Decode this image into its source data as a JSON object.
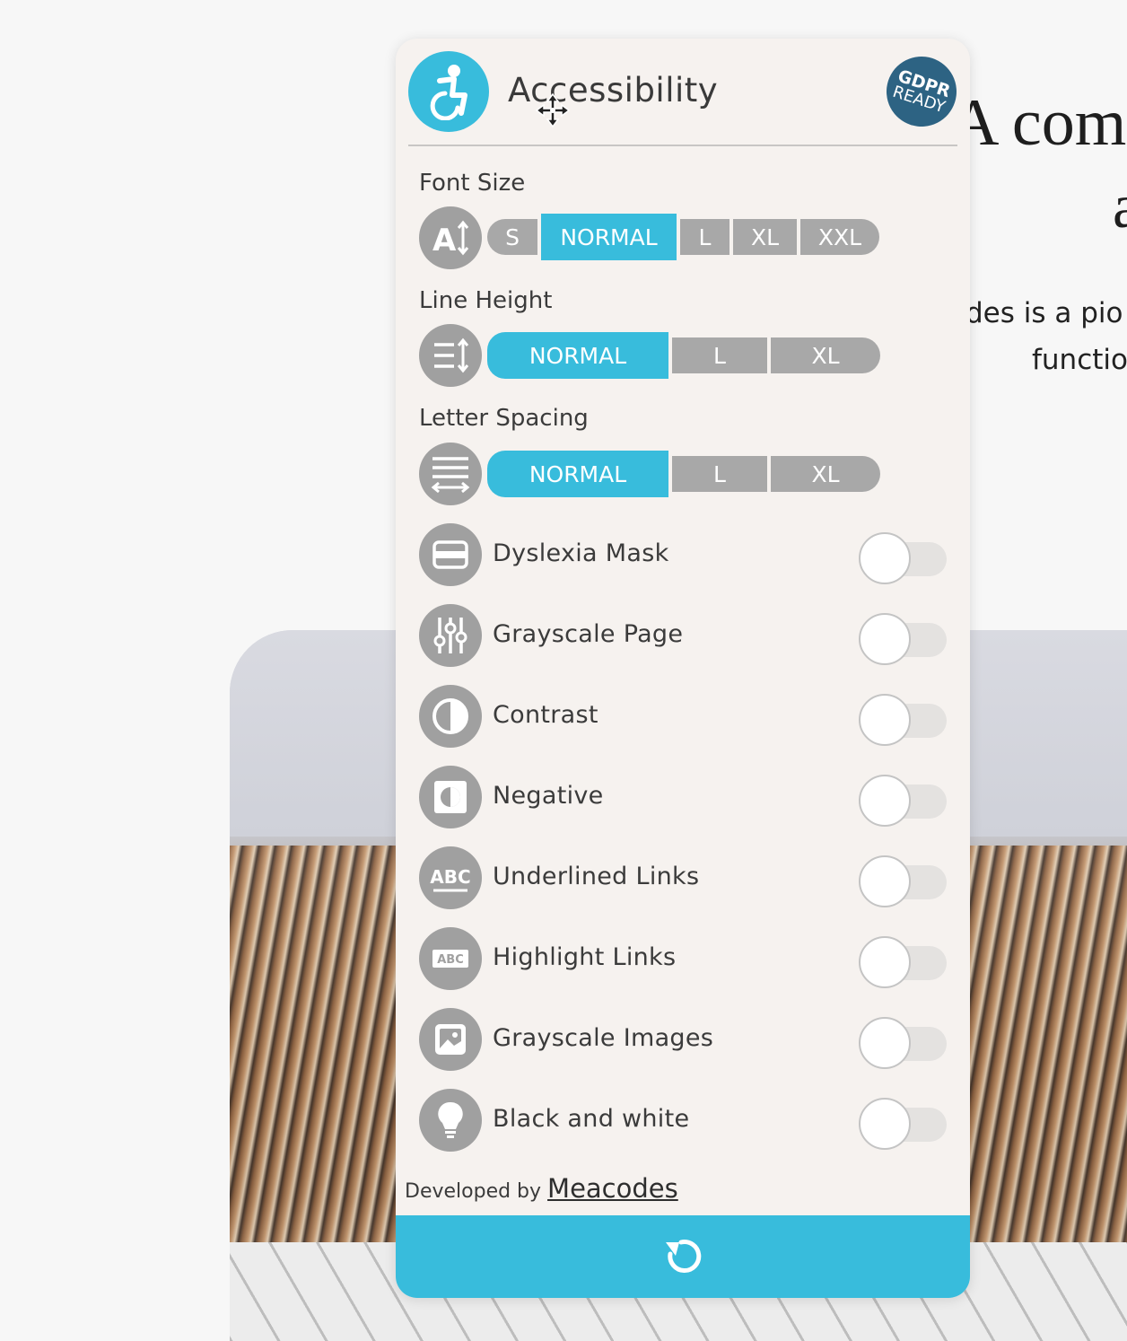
{
  "background": {
    "heading_line1": "A com",
    "heading_line2": "a",
    "para_line1": "des is a pio",
    "para_line2": "functio"
  },
  "widget": {
    "title": "Accessibility",
    "badge": {
      "line1": "GDPR",
      "line2": "READY"
    },
    "font_size": {
      "label": "Font Size",
      "options": [
        "S",
        "NORMAL",
        "L",
        "XL",
        "XXL"
      ],
      "selected": "NORMAL"
    },
    "line_height": {
      "label": "Line Height",
      "options": [
        "NORMAL",
        "L",
        "XL"
      ],
      "selected": "NORMAL"
    },
    "letter_spacing": {
      "label": "Letter Spacing",
      "options": [
        "NORMAL",
        "L",
        "XL"
      ],
      "selected": "NORMAL"
    },
    "toggles": [
      {
        "label": "Dyslexia Mask",
        "icon": "dyslexia-mask-icon",
        "on": false
      },
      {
        "label": "Grayscale Page",
        "icon": "sliders-icon",
        "on": false
      },
      {
        "label": "Contrast",
        "icon": "contrast-icon",
        "on": false
      },
      {
        "label": "Negative",
        "icon": "negative-icon",
        "on": false
      },
      {
        "label": "Underlined Links",
        "icon": "abc-underline-icon",
        "on": false
      },
      {
        "label": "Highlight Links",
        "icon": "abc-highlight-icon",
        "on": false
      },
      {
        "label": "Grayscale Images",
        "icon": "image-icon",
        "on": false
      },
      {
        "label": "Black and white",
        "icon": "lightbulb-icon",
        "on": false
      }
    ],
    "footer": {
      "prefix": "Developed by",
      "link": "Meacodes"
    },
    "reset_icon": "reset-icon"
  },
  "colors": {
    "accent": "#38bcdc",
    "inactive": "#a8a8a8",
    "icon_bg": "#a0a0a0",
    "badge": "#2d6383",
    "panel_bg": "#f6f2ef"
  }
}
